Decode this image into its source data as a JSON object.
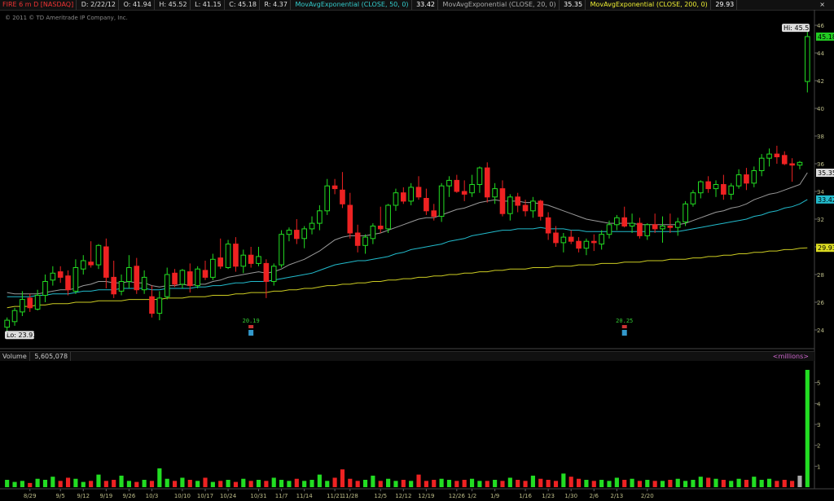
{
  "header": {
    "symbol": "FIRE 6 m D [NASDAQ]",
    "date": "D: 2/22/12",
    "open": "O: 41.94",
    "high": "H: 45.52",
    "low": "L: 41.15",
    "close": "C: 45.18",
    "range": "R: 4.37",
    "ema50_label": "MovAvgExponential (CLOSE, 50, 0)",
    "ema50_value": "33.42",
    "ema20_label": "MovAvgExponential (CLOSE, 20, 0)",
    "ema20_value": "35.35",
    "ema200_label": "MovAvgExponential (CLOSE, 200, 0)",
    "ema200_value": "29.93",
    "close_icon": "×"
  },
  "copyright": "© 2011 © TD Ameritrade IP Company, Inc.",
  "volume_header": {
    "label": "Volume",
    "value": "5,605,078",
    "unit": "<millions>"
  },
  "price_labels": {
    "hi": "Hi: 45.52",
    "lo": "Lo: 23.93",
    "last": "45.18",
    "ema20": "35.35",
    "ema50": "33.42",
    "ema200": "29.93"
  },
  "earnings": [
    {
      "label": "20.19",
      "date_index": 32
    },
    {
      "label": "20.25",
      "date_index": 81
    }
  ],
  "colors": {
    "up": "#22dd22",
    "down": "#ee2222",
    "ema20": "#9a9a9a",
    "ema50": "#22bbcc",
    "ema200": "#cccc22",
    "last_badge": "#22cc22"
  },
  "chart_data": {
    "type": "candlestick",
    "price_axis": {
      "min": 23,
      "max": 47,
      "ticks": [
        24,
        26,
        28,
        30,
        32,
        34,
        36,
        38,
        40,
        42,
        44,
        46
      ]
    },
    "volume_axis": {
      "min": 0,
      "max": 6,
      "ticks": [
        1,
        2,
        3,
        4,
        5
      ]
    },
    "date_ticks": [
      {
        "label": "8/29",
        "i": 3
      },
      {
        "label": "9/5",
        "i": 7
      },
      {
        "label": "9/12",
        "i": 10
      },
      {
        "label": "9/19",
        "i": 13
      },
      {
        "label": "9/26",
        "i": 16
      },
      {
        "label": "10/3",
        "i": 19
      },
      {
        "label": "10/10",
        "i": 23
      },
      {
        "label": "10/17",
        "i": 26
      },
      {
        "label": "10/24",
        "i": 29
      },
      {
        "label": "10/31",
        "i": 33
      },
      {
        "label": "11/7",
        "i": 36
      },
      {
        "label": "11/14",
        "i": 39
      },
      {
        "label": "11/21",
        "i": 43
      },
      {
        "label": "11/28",
        "i": 45
      },
      {
        "label": "12/5",
        "i": 49
      },
      {
        "label": "12/12",
        "i": 52
      },
      {
        "label": "12/19",
        "i": 55
      },
      {
        "label": "12/26",
        "i": 59
      },
      {
        "label": "1/2",
        "i": 61
      },
      {
        "label": "1/9",
        "i": 64
      },
      {
        "label": "1/16",
        "i": 68
      },
      {
        "label": "1/23",
        "i": 71
      },
      {
        "label": "1/30",
        "i": 74
      },
      {
        "label": "2/6",
        "i": 77
      },
      {
        "label": "2/13",
        "i": 80
      },
      {
        "label": "2/20",
        "i": 84
      }
    ],
    "ohlc": [
      [
        24.2,
        24.9,
        23.93,
        24.7
      ],
      [
        24.6,
        25.6,
        24.3,
        25.4
      ],
      [
        25.3,
        26.8,
        25.0,
        26.2
      ],
      [
        26.3,
        26.6,
        25.3,
        25.6
      ],
      [
        25.5,
        26.9,
        25.4,
        26.5
      ],
      [
        26.5,
        28.0,
        26.0,
        27.5
      ],
      [
        27.6,
        28.6,
        27.2,
        28.1
      ],
      [
        28.2,
        28.6,
        27.4,
        27.8
      ],
      [
        27.9,
        28.3,
        26.5,
        26.9
      ],
      [
        26.8,
        29.1,
        26.6,
        28.5
      ],
      [
        28.4,
        29.4,
        28.0,
        29.0
      ],
      [
        28.9,
        30.4,
        28.5,
        28.7
      ],
      [
        28.7,
        30.2,
        28.4,
        30.1
      ],
      [
        30.0,
        30.6,
        27.0,
        27.8
      ],
      [
        27.8,
        29.0,
        26.3,
        26.6
      ],
      [
        26.8,
        28.0,
        26.5,
        27.5
      ],
      [
        27.5,
        29.4,
        27.0,
        28.5
      ],
      [
        28.6,
        29.2,
        26.6,
        26.9
      ],
      [
        26.9,
        28.3,
        26.6,
        27.8
      ],
      [
        26.4,
        27.2,
        24.9,
        25.2
      ],
      [
        25.2,
        26.8,
        24.7,
        26.3
      ],
      [
        26.4,
        28.5,
        26.2,
        28.0
      ],
      [
        28.1,
        28.4,
        27.1,
        27.3
      ],
      [
        27.3,
        28.4,
        27.0,
        28.3
      ],
      [
        28.2,
        28.8,
        26.7,
        27.2
      ],
      [
        27.2,
        28.6,
        27.0,
        28.4
      ],
      [
        28.3,
        29.0,
        27.6,
        27.8
      ],
      [
        27.8,
        29.5,
        27.6,
        29.1
      ],
      [
        29.2,
        30.6,
        28.4,
        28.6
      ],
      [
        28.5,
        30.5,
        28.4,
        30.2
      ],
      [
        30.2,
        30.7,
        28.2,
        28.6
      ],
      [
        28.6,
        29.8,
        28.1,
        29.4
      ],
      [
        29.4,
        30.0,
        28.5,
        28.8
      ],
      [
        28.8,
        30.0,
        28.6,
        29.3
      ],
      [
        28.8,
        29.1,
        26.3,
        27.5
      ],
      [
        27.5,
        28.8,
        27.2,
        28.6
      ],
      [
        28.7,
        31.2,
        28.5,
        30.9
      ],
      [
        30.9,
        31.4,
        30.4,
        31.2
      ],
      [
        31.2,
        32.0,
        30.2,
        30.6
      ],
      [
        30.6,
        31.5,
        29.9,
        31.3
      ],
      [
        31.3,
        32.2,
        30.9,
        31.7
      ],
      [
        31.7,
        33.0,
        31.2,
        32.6
      ],
      [
        32.6,
        34.9,
        32.3,
        34.4
      ],
      [
        34.4,
        34.9,
        33.8,
        34.2
      ],
      [
        34.1,
        35.4,
        32.8,
        33.1
      ],
      [
        33.0,
        33.9,
        30.6,
        31.0
      ],
      [
        31.0,
        31.6,
        29.6,
        30.1
      ],
      [
        30.1,
        30.9,
        29.5,
        30.7
      ],
      [
        30.6,
        31.7,
        30.2,
        31.5
      ],
      [
        31.5,
        32.9,
        31.0,
        31.3
      ],
      [
        31.3,
        33.1,
        31.0,
        33.0
      ],
      [
        33.0,
        34.2,
        32.6,
        33.9
      ],
      [
        33.9,
        34.3,
        33.1,
        33.3
      ],
      [
        33.3,
        34.6,
        33.0,
        34.3
      ],
      [
        34.3,
        35.1,
        33.4,
        33.6
      ],
      [
        33.5,
        34.2,
        32.3,
        32.6
      ],
      [
        32.6,
        33.1,
        31.9,
        32.2
      ],
      [
        32.2,
        34.6,
        31.8,
        34.4
      ],
      [
        34.4,
        35.1,
        33.6,
        34.8
      ],
      [
        34.8,
        35.2,
        33.9,
        34.0
      ],
      [
        34.0,
        34.8,
        33.3,
        33.8
      ],
      [
        33.9,
        35.2,
        33.6,
        34.5
      ],
      [
        34.5,
        35.8,
        33.9,
        35.7
      ],
      [
        35.7,
        36.1,
        33.2,
        33.6
      ],
      [
        33.6,
        34.6,
        33.1,
        34.2
      ],
      [
        34.2,
        34.8,
        32.2,
        32.4
      ],
      [
        32.4,
        33.8,
        31.9,
        33.6
      ],
      [
        33.6,
        33.9,
        32.5,
        33.0
      ],
      [
        33.0,
        33.4,
        32.2,
        32.6
      ],
      [
        32.6,
        33.6,
        32.1,
        33.3
      ],
      [
        33.3,
        33.4,
        31.9,
        32.2
      ],
      [
        32.1,
        32.5,
        30.5,
        31.0
      ],
      [
        31.0,
        31.5,
        30.0,
        30.3
      ],
      [
        30.3,
        31.0,
        29.6,
        30.7
      ],
      [
        30.7,
        31.2,
        30.2,
        30.4
      ],
      [
        30.4,
        30.7,
        29.6,
        29.9
      ],
      [
        29.9,
        30.6,
        29.4,
        30.4
      ],
      [
        30.4,
        30.9,
        29.7,
        30.3
      ],
      [
        30.2,
        31.2,
        29.8,
        30.9
      ],
      [
        30.9,
        31.9,
        30.6,
        31.6
      ],
      [
        31.6,
        32.3,
        31.2,
        32.1
      ],
      [
        32.1,
        32.9,
        31.4,
        31.5
      ],
      [
        31.5,
        32.4,
        31.0,
        31.7
      ],
      [
        31.7,
        32.1,
        30.6,
        30.8
      ],
      [
        30.8,
        31.7,
        30.5,
        31.6
      ],
      [
        31.6,
        32.4,
        31.0,
        31.3
      ],
      [
        31.3,
        32.2,
        30.3,
        31.5
      ],
      [
        31.5,
        32.4,
        31.0,
        31.4
      ],
      [
        31.4,
        32.1,
        30.8,
        31.8
      ],
      [
        31.8,
        33.3,
        31.5,
        33.1
      ],
      [
        33.1,
        34.1,
        32.9,
        33.9
      ],
      [
        33.9,
        34.8,
        33.5,
        34.7
      ],
      [
        34.7,
        35.1,
        33.9,
        34.2
      ],
      [
        34.2,
        34.8,
        33.6,
        34.5
      ],
      [
        34.5,
        35.2,
        33.4,
        33.8
      ],
      [
        33.8,
        34.6,
        33.4,
        34.4
      ],
      [
        34.4,
        35.6,
        34.2,
        35.2
      ],
      [
        35.2,
        35.7,
        34.1,
        34.6
      ],
      [
        34.6,
        35.8,
        34.3,
        35.5
      ],
      [
        35.5,
        36.7,
        35.1,
        36.4
      ],
      [
        36.4,
        37.1,
        35.8,
        36.7
      ],
      [
        36.7,
        37.3,
        36.0,
        36.5
      ],
      [
        36.6,
        36.9,
        35.9,
        36.0
      ],
      [
        36.0,
        36.4,
        34.7,
        35.9
      ],
      [
        35.9,
        36.2,
        35.6,
        36.1
      ],
      [
        41.94,
        45.52,
        41.15,
        45.18
      ]
    ],
    "ema20": [
      26.7,
      26.6,
      26.6,
      26.6,
      26.6,
      26.7,
      26.8,
      26.9,
      26.9,
      27.0,
      27.2,
      27.3,
      27.5,
      27.5,
      27.4,
      27.4,
      27.5,
      27.4,
      27.4,
      27.2,
      27.1,
      27.2,
      27.2,
      27.3,
      27.2,
      27.3,
      27.3,
      27.5,
      27.6,
      27.8,
      27.9,
      28.0,
      28.1,
      28.2,
      28.1,
      28.2,
      28.4,
      28.7,
      28.9,
      29.1,
      29.4,
      29.7,
      30.1,
      30.5,
      30.7,
      30.8,
      30.8,
      30.8,
      30.9,
      31.0,
      31.2,
      31.4,
      31.6,
      31.8,
      32.0,
      32.1,
      32.1,
      32.3,
      32.5,
      32.7,
      32.8,
      33.0,
      33.2,
      33.3,
      33.4,
      33.3,
      33.3,
      33.3,
      33.2,
      33.2,
      33.1,
      33.0,
      32.8,
      32.6,
      32.4,
      32.2,
      32.0,
      31.9,
      31.8,
      31.7,
      31.7,
      31.7,
      31.7,
      31.6,
      31.6,
      31.6,
      31.6,
      31.6,
      31.6,
      31.7,
      31.9,
      32.1,
      32.3,
      32.5,
      32.6,
      32.8,
      32.9,
      33.1,
      33.4,
      33.6,
      33.8,
      33.9,
      34.1,
      34.3,
      34.5,
      35.35
    ],
    "ema50": [
      26.4,
      26.4,
      26.4,
      26.4,
      26.5,
      26.5,
      26.6,
      26.6,
      26.6,
      26.7,
      26.8,
      26.8,
      26.9,
      26.9,
      26.9,
      27.0,
      27.0,
      27.0,
      27.0,
      26.9,
      26.9,
      27.0,
      27.0,
      27.0,
      27.0,
      27.1,
      27.1,
      27.2,
      27.2,
      27.3,
      27.4,
      27.4,
      27.5,
      27.5,
      27.5,
      27.6,
      27.7,
      27.8,
      27.9,
      28.0,
      28.1,
      28.3,
      28.5,
      28.7,
      28.8,
      28.9,
      29.0,
      29.0,
      29.1,
      29.2,
      29.3,
      29.5,
      29.6,
      29.8,
      29.9,
      30.0,
      30.1,
      30.2,
      30.4,
      30.5,
      30.6,
      30.8,
      30.9,
      31.0,
      31.1,
      31.2,
      31.2,
      31.3,
      31.3,
      31.3,
      31.4,
      31.3,
      31.3,
      31.3,
      31.2,
      31.2,
      31.1,
      31.1,
      31.1,
      31.1,
      31.1,
      31.1,
      31.1,
      31.1,
      31.1,
      31.1,
      31.1,
      31.1,
      31.1,
      31.2,
      31.3,
      31.4,
      31.5,
      31.6,
      31.7,
      31.8,
      31.9,
      32.0,
      32.2,
      32.3,
      32.5,
      32.6,
      32.8,
      32.9,
      33.1,
      33.42
    ],
    "ema200": [
      25.6,
      25.7,
      25.7,
      25.7,
      25.8,
      25.8,
      25.9,
      25.9,
      25.9,
      26.0,
      26.0,
      26.0,
      26.1,
      26.1,
      26.1,
      26.1,
      26.2,
      26.2,
      26.2,
      26.2,
      26.2,
      26.3,
      26.3,
      26.3,
      26.4,
      26.4,
      26.4,
      26.5,
      26.5,
      26.5,
      26.6,
      26.6,
      26.7,
      26.7,
      26.7,
      26.8,
      26.8,
      26.9,
      26.9,
      27.0,
      27.0,
      27.1,
      27.2,
      27.2,
      27.3,
      27.3,
      27.4,
      27.4,
      27.5,
      27.5,
      27.6,
      27.6,
      27.7,
      27.7,
      27.8,
      27.8,
      27.9,
      27.9,
      28.0,
      28.0,
      28.1,
      28.1,
      28.2,
      28.2,
      28.3,
      28.3,
      28.4,
      28.4,
      28.4,
      28.5,
      28.5,
      28.5,
      28.6,
      28.6,
      28.6,
      28.7,
      28.7,
      28.7,
      28.8,
      28.8,
      28.8,
      28.9,
      28.9,
      28.9,
      29.0,
      29.0,
      29.0,
      29.1,
      29.1,
      29.1,
      29.2,
      29.2,
      29.3,
      29.3,
      29.4,
      29.4,
      29.5,
      29.5,
      29.6,
      29.6,
      29.7,
      29.7,
      29.8,
      29.8,
      29.9,
      29.93
    ],
    "volume": [
      0.35,
      0.25,
      0.3,
      0.2,
      0.4,
      0.35,
      0.5,
      0.3,
      0.45,
      0.4,
      0.25,
      0.3,
      0.6,
      0.3,
      0.35,
      0.55,
      0.3,
      0.25,
      0.35,
      0.3,
      0.9,
      0.4,
      0.3,
      0.45,
      0.35,
      0.3,
      0.45,
      0.25,
      0.3,
      0.35,
      0.25,
      0.4,
      0.3,
      0.35,
      0.3,
      0.45,
      0.35,
      0.3,
      0.4,
      0.3,
      0.35,
      0.6,
      0.3,
      0.45,
      0.85,
      0.4,
      0.3,
      0.35,
      0.55,
      0.3,
      0.4,
      0.3,
      0.35,
      0.3,
      0.6,
      0.3,
      0.35,
      0.4,
      0.35,
      0.3,
      0.35,
      0.4,
      0.3,
      0.3,
      0.35,
      0.3,
      0.45,
      0.35,
      0.3,
      0.55,
      0.4,
      0.35,
      0.3,
      0.65,
      0.5,
      0.4,
      0.35,
      0.3,
      0.35,
      0.3,
      0.45,
      0.35,
      0.4,
      0.3,
      0.35,
      0.3,
      0.3,
      0.35,
      0.4,
      0.3,
      0.35,
      0.5,
      0.45,
      0.4,
      0.35,
      0.3,
      0.4,
      0.35,
      0.5,
      0.35,
      0.4,
      0.3,
      0.35,
      0.3,
      0.55,
      5.61
    ]
  }
}
